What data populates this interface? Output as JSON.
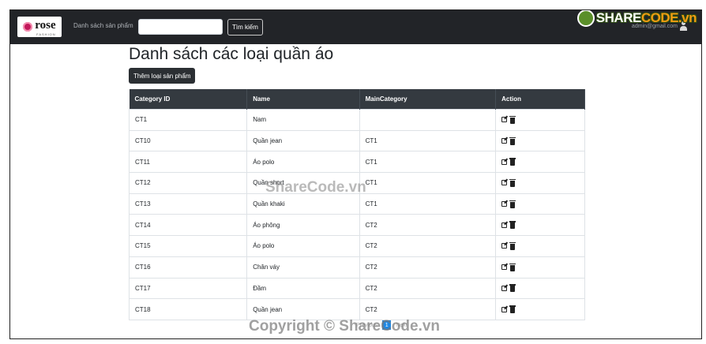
{
  "navbar": {
    "brand": "rose",
    "brand_sub": "FASHION",
    "nav_link": "Danh sách sản phẩm",
    "search_placeholder": "",
    "search_value": "",
    "search_button": "Tìm kiếm",
    "user_email": "admin@gmail.com",
    "watermark_logo_left": "SHARE",
    "watermark_logo_right": "CODE.vn"
  },
  "page": {
    "title": "Danh sách các loại quần áo",
    "add_button": "Thêm loại sản phẩm"
  },
  "table": {
    "headers": [
      "Category ID",
      "Name",
      "MainCategory",
      "Action"
    ],
    "rows": [
      {
        "id": "CT1",
        "name": "Nam",
        "main": ""
      },
      {
        "id": "CT10",
        "name": "Quần jean",
        "main": "CT1"
      },
      {
        "id": "CT11",
        "name": "Áo polo",
        "main": "CT1"
      },
      {
        "id": "CT12",
        "name": "Quần short",
        "main": "CT1"
      },
      {
        "id": "CT13",
        "name": "Quần khaki",
        "main": "CT1"
      },
      {
        "id": "CT14",
        "name": "Áo phông",
        "main": "CT2"
      },
      {
        "id": "CT15",
        "name": "Áo polo",
        "main": "CT2"
      },
      {
        "id": "CT16",
        "name": "Chân váy",
        "main": "CT2"
      },
      {
        "id": "CT17",
        "name": "Đầm",
        "main": "CT2"
      },
      {
        "id": "CT18",
        "name": "Quần jean",
        "main": "CT2"
      }
    ]
  },
  "pagination": {
    "prev": "Previous",
    "current": "1",
    "next": "Next"
  },
  "watermarks": {
    "center": "ShareCode.vn",
    "bottom": "Copyright © ShareCode.vn"
  }
}
